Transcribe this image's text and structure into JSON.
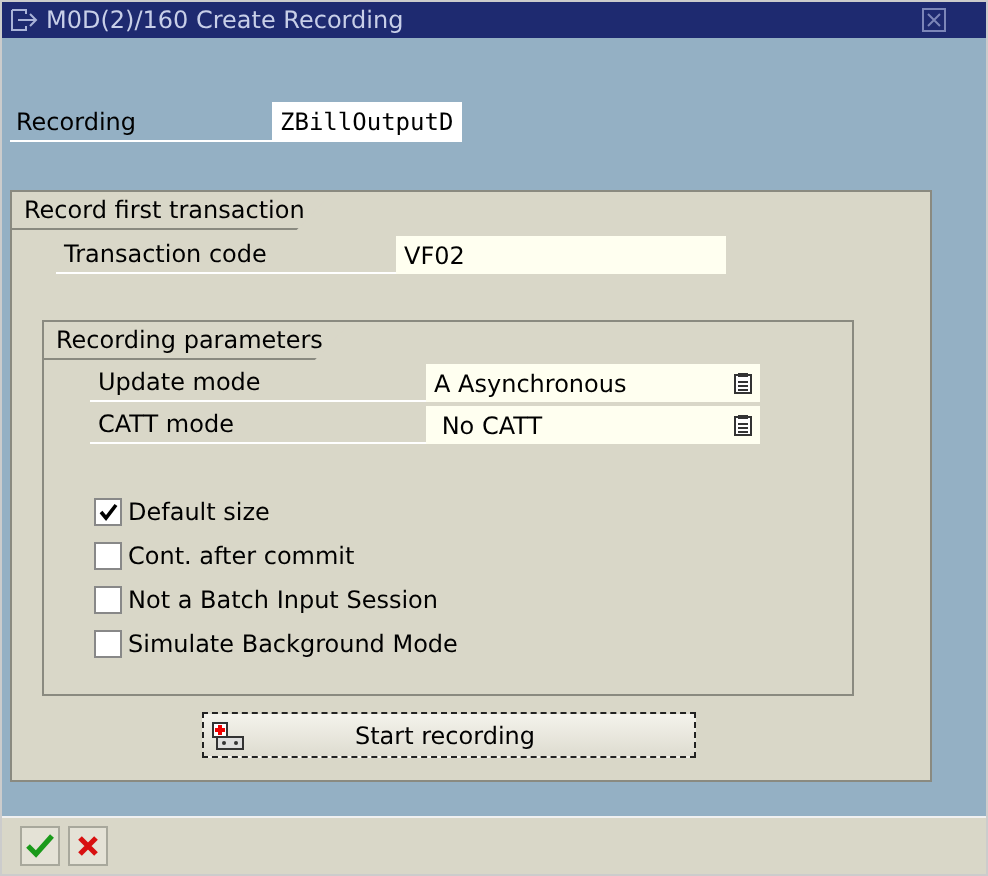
{
  "window": {
    "title": "M0D(2)/160 Create Recording"
  },
  "recording": {
    "label": "Recording",
    "value": "ZBillOutputD"
  },
  "transaction_group": {
    "title": "Record first transaction",
    "label": "Transaction code",
    "value": "VF02"
  },
  "parameters_group": {
    "title": "Recording parameters",
    "fields": [
      {
        "label": "Update mode",
        "value": "A Asynchronous"
      },
      {
        "label": "CATT mode",
        "value": " No CATT"
      }
    ],
    "options": [
      {
        "label": "Default size",
        "checked": true
      },
      {
        "label": "Cont. after commit",
        "checked": false
      },
      {
        "label": "Not a Batch Input Session",
        "checked": false
      },
      {
        "label": "Simulate Background Mode",
        "checked": false
      }
    ]
  },
  "start_button": {
    "label": "Start recording"
  }
}
